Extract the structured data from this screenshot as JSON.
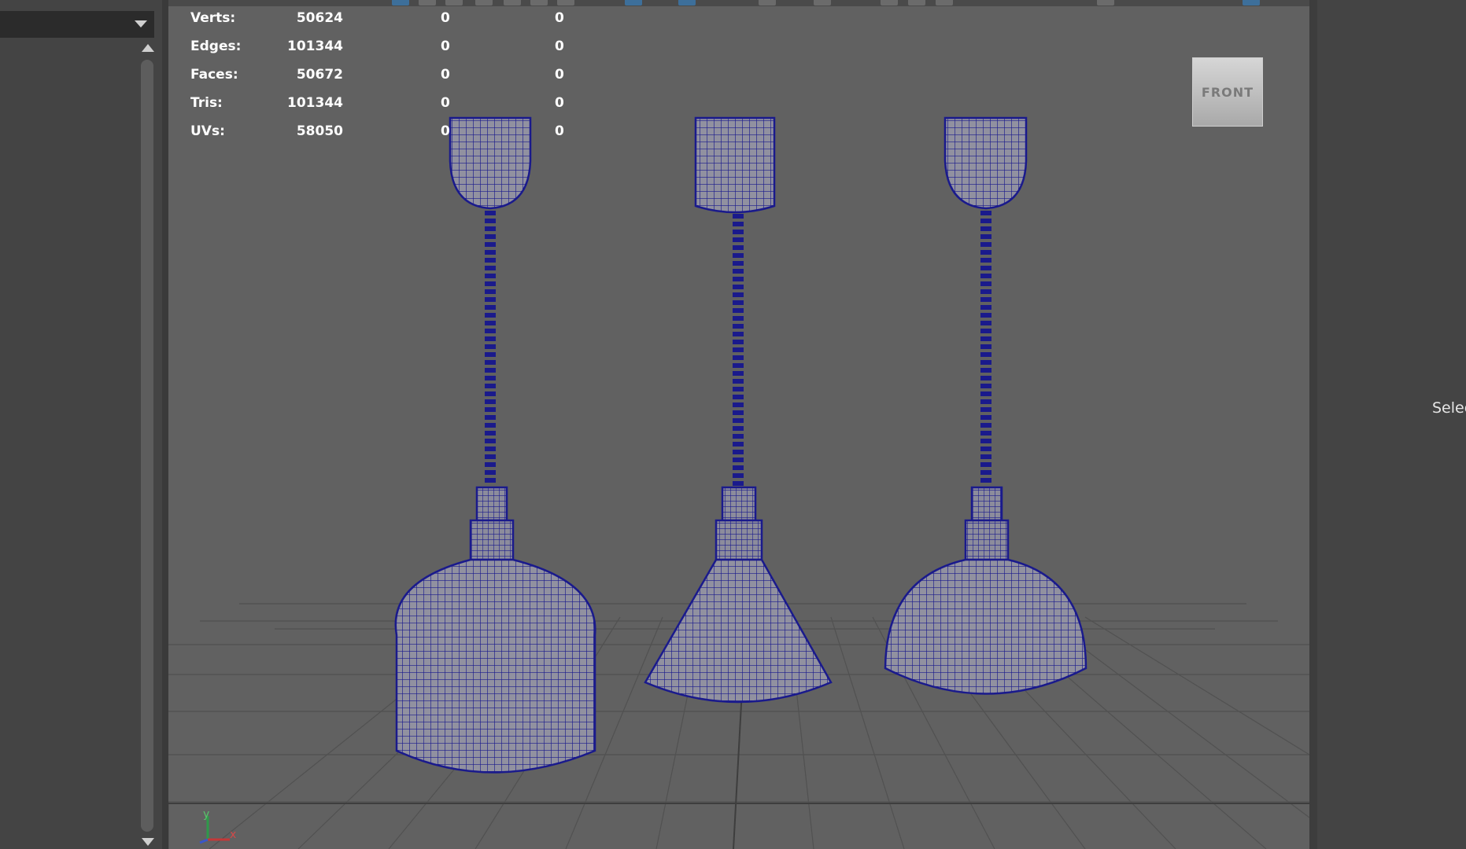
{
  "left_panel": {
    "dropdown_icon": "chevron-down-icon"
  },
  "viewport": {
    "stats": [
      {
        "label": "Verts:",
        "v1": "50624",
        "v2": "0",
        "v3": "0"
      },
      {
        "label": "Edges:",
        "v1": "101344",
        "v2": "0",
        "v3": "0"
      },
      {
        "label": "Faces:",
        "v1": "50672",
        "v2": "0",
        "v3": "0"
      },
      {
        "label": "Tris:",
        "v1": "101344",
        "v2": "0",
        "v3": "0"
      },
      {
        "label": "UVs:",
        "v1": "58050",
        "v2": "0",
        "v3": "0"
      }
    ],
    "view_cube_label": "FRONT",
    "axis": {
      "y_label": "y",
      "x_label": "x"
    }
  },
  "right_panel": {
    "label": "Selec"
  },
  "colors": {
    "wireframe": "#1a1a8c",
    "mesh_fill": "#8f8f9c",
    "viewport_bg": "#616161",
    "grid_line": "#505050"
  }
}
